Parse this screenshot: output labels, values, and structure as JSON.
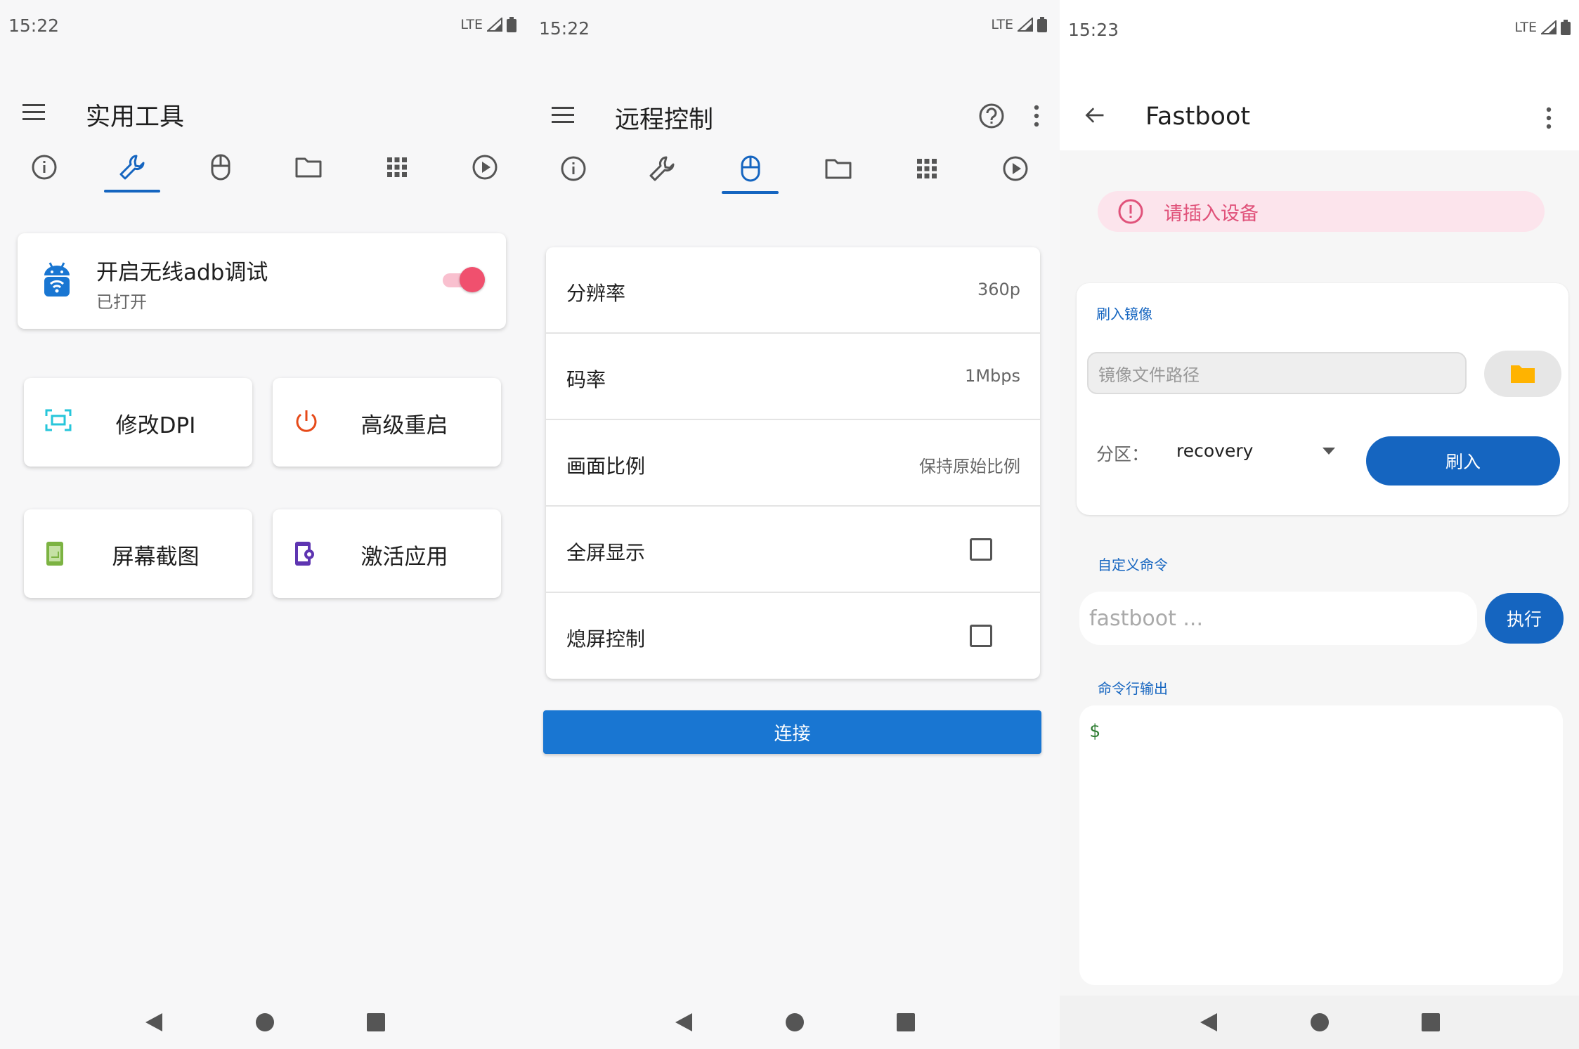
{
  "screens": [
    {
      "status": {
        "time": "15:22",
        "network": "LTE"
      },
      "title": "实用工具",
      "tabs": [
        "info-icon",
        "wrench-icon",
        "mouse-icon",
        "folder-icon",
        "apps-grid-icon",
        "play-circle-icon"
      ],
      "active_tab": 1,
      "adb_card": {
        "title": "开启无线adb调试",
        "subtitle": "已打开",
        "enabled": true
      },
      "tools": [
        {
          "label": "修改DPI",
          "icon": "screen-frame-icon",
          "color": "#26c6da"
        },
        {
          "label": "高级重启",
          "icon": "power-icon",
          "color": "#e64a19"
        },
        {
          "label": "屏幕截图",
          "icon": "phone-screenshot-icon",
          "color": "#7cb342"
        },
        {
          "label": "激活应用",
          "icon": "phone-settings-icon",
          "color": "#5e35b1"
        }
      ]
    },
    {
      "status": {
        "time": "15:22",
        "network": "LTE"
      },
      "title": "远程控制",
      "tabs": [
        "info-icon",
        "wrench-icon",
        "mouse-icon",
        "folder-icon",
        "apps-grid-icon",
        "play-circle-icon"
      ],
      "active_tab": 2,
      "settings": [
        {
          "label": "分辨率",
          "value": "360p"
        },
        {
          "label": "码率",
          "value": "1Mbps"
        },
        {
          "label": "画面比例",
          "value": "保持原始比例"
        },
        {
          "label": "全屏显示",
          "checked": false
        },
        {
          "label": "熄屏控制",
          "checked": false
        }
      ],
      "connect_label": "连接"
    },
    {
      "status": {
        "time": "15:23",
        "network": "LTE"
      },
      "title": "Fastboot",
      "warning": "请插入设备",
      "flash_section": {
        "label": "刷入镜像",
        "path_placeholder": "镜像文件路径",
        "partition_label": "分区：",
        "partition_value": "recovery",
        "flash_button": "刷入"
      },
      "custom_cmd": {
        "label": "自定义命令",
        "placeholder": "fastboot ...",
        "exec_button": "执行"
      },
      "output": {
        "label": "命令行输出",
        "prompt": "$"
      }
    }
  ],
  "colors": {
    "accent": "#1565c0",
    "warning": "#e0527a",
    "toggle": "#f0506e",
    "folder": "#ffb300"
  }
}
